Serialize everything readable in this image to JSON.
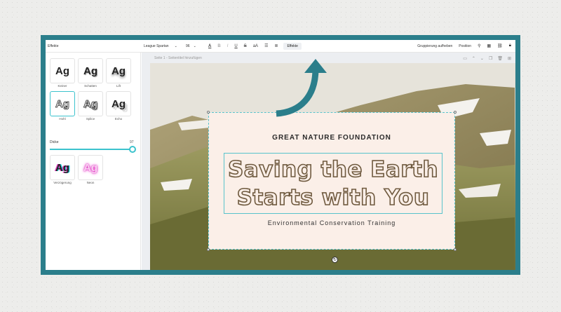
{
  "panel": {
    "title": "Effekte",
    "effects": [
      {
        "label": "Keiner",
        "sample": "Ag"
      },
      {
        "label": "Schatten",
        "sample": "Ag"
      },
      {
        "label": "Lift",
        "sample": "Ag"
      },
      {
        "label": "Hohl",
        "sample": "Ag"
      },
      {
        "label": "Splice",
        "sample": "Ag"
      },
      {
        "label": "Echo",
        "sample": "Ag"
      },
      {
        "label": "Verzögerung",
        "sample": "Ag"
      },
      {
        "label": "Neon",
        "sample": "Ag"
      }
    ],
    "slider": {
      "label": "Dicke",
      "value": "97"
    }
  },
  "toolbar": {
    "font": "League Spartan",
    "size": "96",
    "bold_icon": "B",
    "italic_icon": "I",
    "underline_icon": "U",
    "strike_icon": "S",
    "case_icon": "aA",
    "effects_label": "Effekte",
    "ungroup_label": "Gruppierung aufheben",
    "position_label": "Position"
  },
  "canvas": {
    "page_label": "Seite 1 - Seitentitel hinzufügen",
    "organization": "GREAT NATURE FOUNDATION",
    "headline_line1": "Saving the Earth",
    "headline_line2": "Starts with You",
    "subtitle": "Environmental Conservation Training"
  },
  "colors": {
    "frame": "#2b7e8b",
    "accent": "#3cc3cd",
    "card": "#fbefe8",
    "headline_stroke": "#6f5a3f"
  }
}
